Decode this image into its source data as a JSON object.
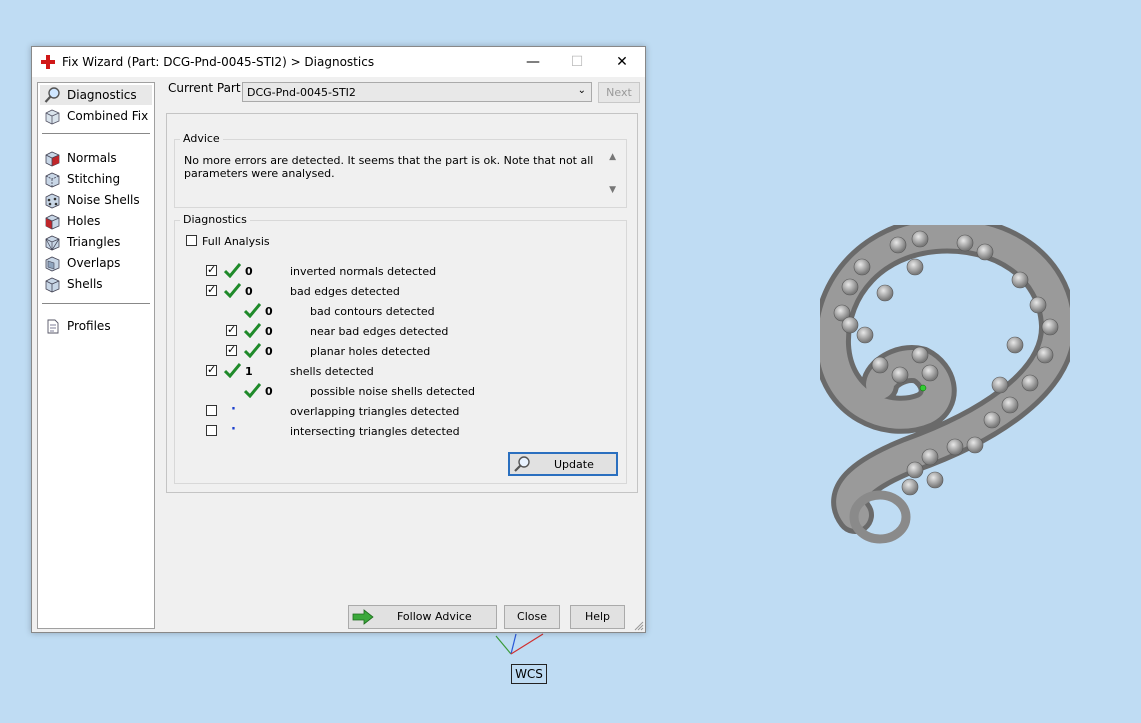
{
  "window": {
    "title": "Fix Wizard (Part: DCG-Pnd-0045-STI2) > Diagnostics",
    "minimize_glyph": "—",
    "maximize_glyph": "☐",
    "close_glyph": "✕"
  },
  "nav": {
    "items": [
      {
        "label": "Diagnostics",
        "icon": "magnifier-icon",
        "selected": true
      },
      {
        "label": "Combined Fix",
        "icon": "cube-icon"
      },
      {
        "label": "Normals",
        "icon": "cube-normals-icon"
      },
      {
        "label": "Stitching",
        "icon": "cube-stitching-icon"
      },
      {
        "label": "Noise Shells",
        "icon": "cube-noise-icon"
      },
      {
        "label": "Holes",
        "icon": "cube-holes-icon"
      },
      {
        "label": "Triangles",
        "icon": "cube-triangles-icon"
      },
      {
        "label": "Overlaps",
        "icon": "cube-overlaps-icon"
      },
      {
        "label": "Shells",
        "icon": "cube-shells-icon"
      },
      {
        "label": "Profiles",
        "icon": "document-icon"
      }
    ]
  },
  "current_part": {
    "label": "Current Part:",
    "value": "DCG-Pnd-0045-STI2",
    "next_label": "Next"
  },
  "advice": {
    "title": "Advice",
    "text": "No more errors are detected. It seems that the part is ok. Note that not all parameters were analysed."
  },
  "diagnostics": {
    "title": "Diagnostics",
    "full_analysis_label": "Full Analysis",
    "full_analysis_checked": false,
    "rows": [
      {
        "checked": true,
        "status": "ok",
        "count": "0",
        "label": "inverted normals detected"
      },
      {
        "checked": true,
        "status": "ok",
        "count": "0",
        "label": "bad edges detected"
      },
      {
        "checked": null,
        "status": "ok",
        "count": "0",
        "label": "bad contours detected"
      },
      {
        "checked": true,
        "status": "ok",
        "count": "0",
        "label": "near bad edges detected"
      },
      {
        "checked": true,
        "status": "ok",
        "count": "0",
        "label": "planar holes detected"
      },
      {
        "checked": true,
        "status": "ok",
        "count": "1",
        "label": "shells detected"
      },
      {
        "checked": null,
        "status": "ok",
        "count": "0",
        "label": "possible noise shells detected"
      },
      {
        "checked": false,
        "status": "not-run",
        "count": "",
        "label": "overlapping triangles detected"
      },
      {
        "checked": false,
        "status": "not-run",
        "count": "",
        "label": "intersecting triangles detected"
      }
    ],
    "update_label": "Update"
  },
  "footer": {
    "follow_advice_label": "Follow Advice",
    "close_label": "Close",
    "help_label": "Help"
  },
  "viewport": {
    "wcs_label": "WCS"
  },
  "colors": {
    "desktop_bg": "#bfdcf3",
    "ok_green": "#1f8a2a",
    "not_run_blue": "#1b3fcc",
    "focus_border": "#2a6fbf"
  }
}
